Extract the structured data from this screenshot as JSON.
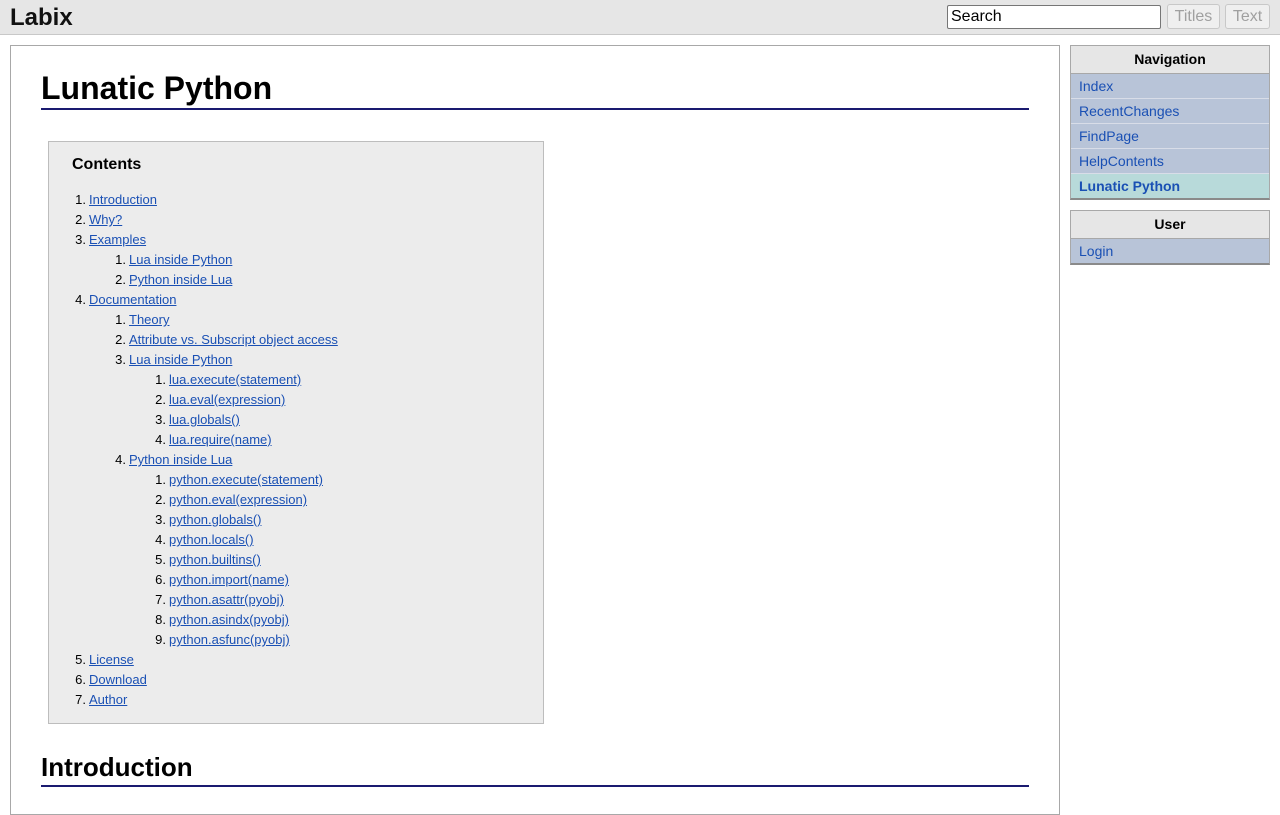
{
  "header": {
    "logo": "Labix",
    "search_value": "Search",
    "titles_button": "Titles",
    "text_button": "Text"
  },
  "page": {
    "title": "Lunatic Python",
    "section_title": "Introduction"
  },
  "toc": {
    "title": "Contents",
    "items": [
      {
        "num": "1.",
        "label": "Introduction",
        "level": 1
      },
      {
        "num": "2.",
        "label": "Why?",
        "level": 1
      },
      {
        "num": "3.",
        "label": "Examples",
        "level": 1
      },
      {
        "num": "1.",
        "label": "Lua inside Python",
        "level": 2
      },
      {
        "num": "2.",
        "label": "Python inside Lua",
        "level": 2
      },
      {
        "num": "4.",
        "label": "Documentation",
        "level": 1
      },
      {
        "num": "1.",
        "label": "Theory",
        "level": 2
      },
      {
        "num": "2.",
        "label": "Attribute vs. Subscript object access",
        "level": 2
      },
      {
        "num": "3.",
        "label": "Lua inside Python",
        "level": 2
      },
      {
        "num": "1.",
        "label": "lua.execute(statement)",
        "level": 3
      },
      {
        "num": "2.",
        "label": "lua.eval(expression)",
        "level": 3
      },
      {
        "num": "3.",
        "label": "lua.globals()",
        "level": 3
      },
      {
        "num": "4.",
        "label": "lua.require(name)",
        "level": 3
      },
      {
        "num": "4.",
        "label": "Python inside Lua",
        "level": 2
      },
      {
        "num": "1.",
        "label": "python.execute(statement)",
        "level": 3
      },
      {
        "num": "2.",
        "label": "python.eval(expression)",
        "level": 3
      },
      {
        "num": "3.",
        "label": "python.globals()",
        "level": 3
      },
      {
        "num": "4.",
        "label": "python.locals()",
        "level": 3
      },
      {
        "num": "5.",
        "label": "python.builtins()",
        "level": 3
      },
      {
        "num": "6.",
        "label": "python.import(name)",
        "level": 3
      },
      {
        "num": "7.",
        "label": "python.asattr(pyobj)",
        "level": 3
      },
      {
        "num": "8.",
        "label": "python.asindx(pyobj)",
        "level": 3
      },
      {
        "num": "9.",
        "label": "python.asfunc(pyobj)",
        "level": 3
      },
      {
        "num": "5.",
        "label": "License",
        "level": 1
      },
      {
        "num": "6.",
        "label": "Download",
        "level": 1
      },
      {
        "num": "7.",
        "label": "Author",
        "level": 1
      }
    ]
  },
  "sidebar": {
    "navigation": {
      "title": "Navigation",
      "items": [
        {
          "label": "Index",
          "current": false
        },
        {
          "label": "RecentChanges",
          "current": false
        },
        {
          "label": "FindPage",
          "current": false
        },
        {
          "label": "HelpContents",
          "current": false
        },
        {
          "label": "Lunatic Python",
          "current": true
        }
      ]
    },
    "user": {
      "title": "User",
      "items": [
        {
          "label": "Login",
          "current": false
        }
      ]
    }
  },
  "colors": {
    "link": "#1a50b4",
    "heading_rule": "#1a1a70",
    "sidebar_item_bg": "#b8c4d8",
    "sidebar_current_bg": "#b8dada",
    "toc_bg": "#ececec",
    "header_bg": "#e6e6e6"
  }
}
